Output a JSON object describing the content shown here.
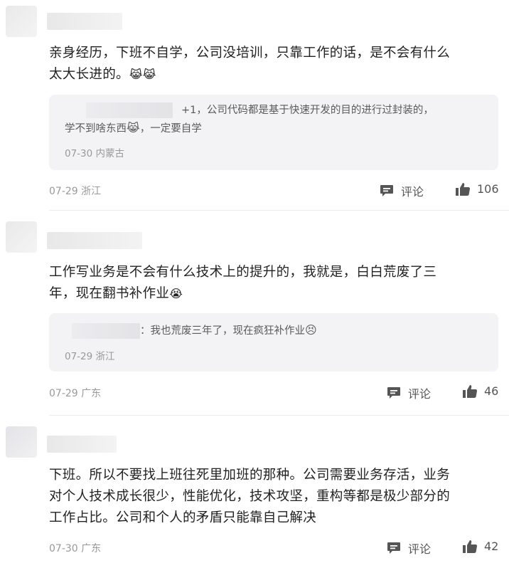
{
  "comments": [
    {
      "text_line1": "亲身经历，下班不自学，公司没培训，只靠工作的话，是不会有什么",
      "text_line2": "太大长进的。",
      "text_emoji": "😹😹",
      "reply": {
        "line1": "+1，公司代码都是基于快速开发的目的进行过封装的，",
        "line2": "学不到啥东西",
        "line2_emoji": "😹",
        "line2_tail": "，一定要自学",
        "meta": "07-30 内蒙古"
      },
      "meta": "07-29 浙江",
      "comment_label": "评论",
      "likes": "106"
    },
    {
      "text_line1": "工作写业务是不会有什么技术上的提升的，我就是，白白荒废了三",
      "text_line2": "年，现在翻书补作业",
      "text_emoji": "😭",
      "reply": {
        "line1": "：我也荒废三年了，现在疯狂补作业",
        "line1_emoji": "😣",
        "meta": "07-29 浙江"
      },
      "meta": "07-29 广东",
      "comment_label": "评论",
      "likes": "46"
    },
    {
      "text_line1": "下班。所以不要找上班往死里加班的那种。公司需要业务存活，业务",
      "text_line2": "对个人技术成长很少，性能优化，技术攻坚，重构等都是极少部分的",
      "text_line3": "工作占比。公司和个人的矛盾只能靠自己解决",
      "meta": "07-30 广东",
      "comment_label": "评论",
      "likes": "42"
    }
  ],
  "icons": {
    "comment": "comment-bubble-icon",
    "like": "thumbs-up-icon"
  },
  "colors": {
    "reply_bg": "#f3f3f6",
    "meta": "#999999",
    "icon": "#555555"
  }
}
